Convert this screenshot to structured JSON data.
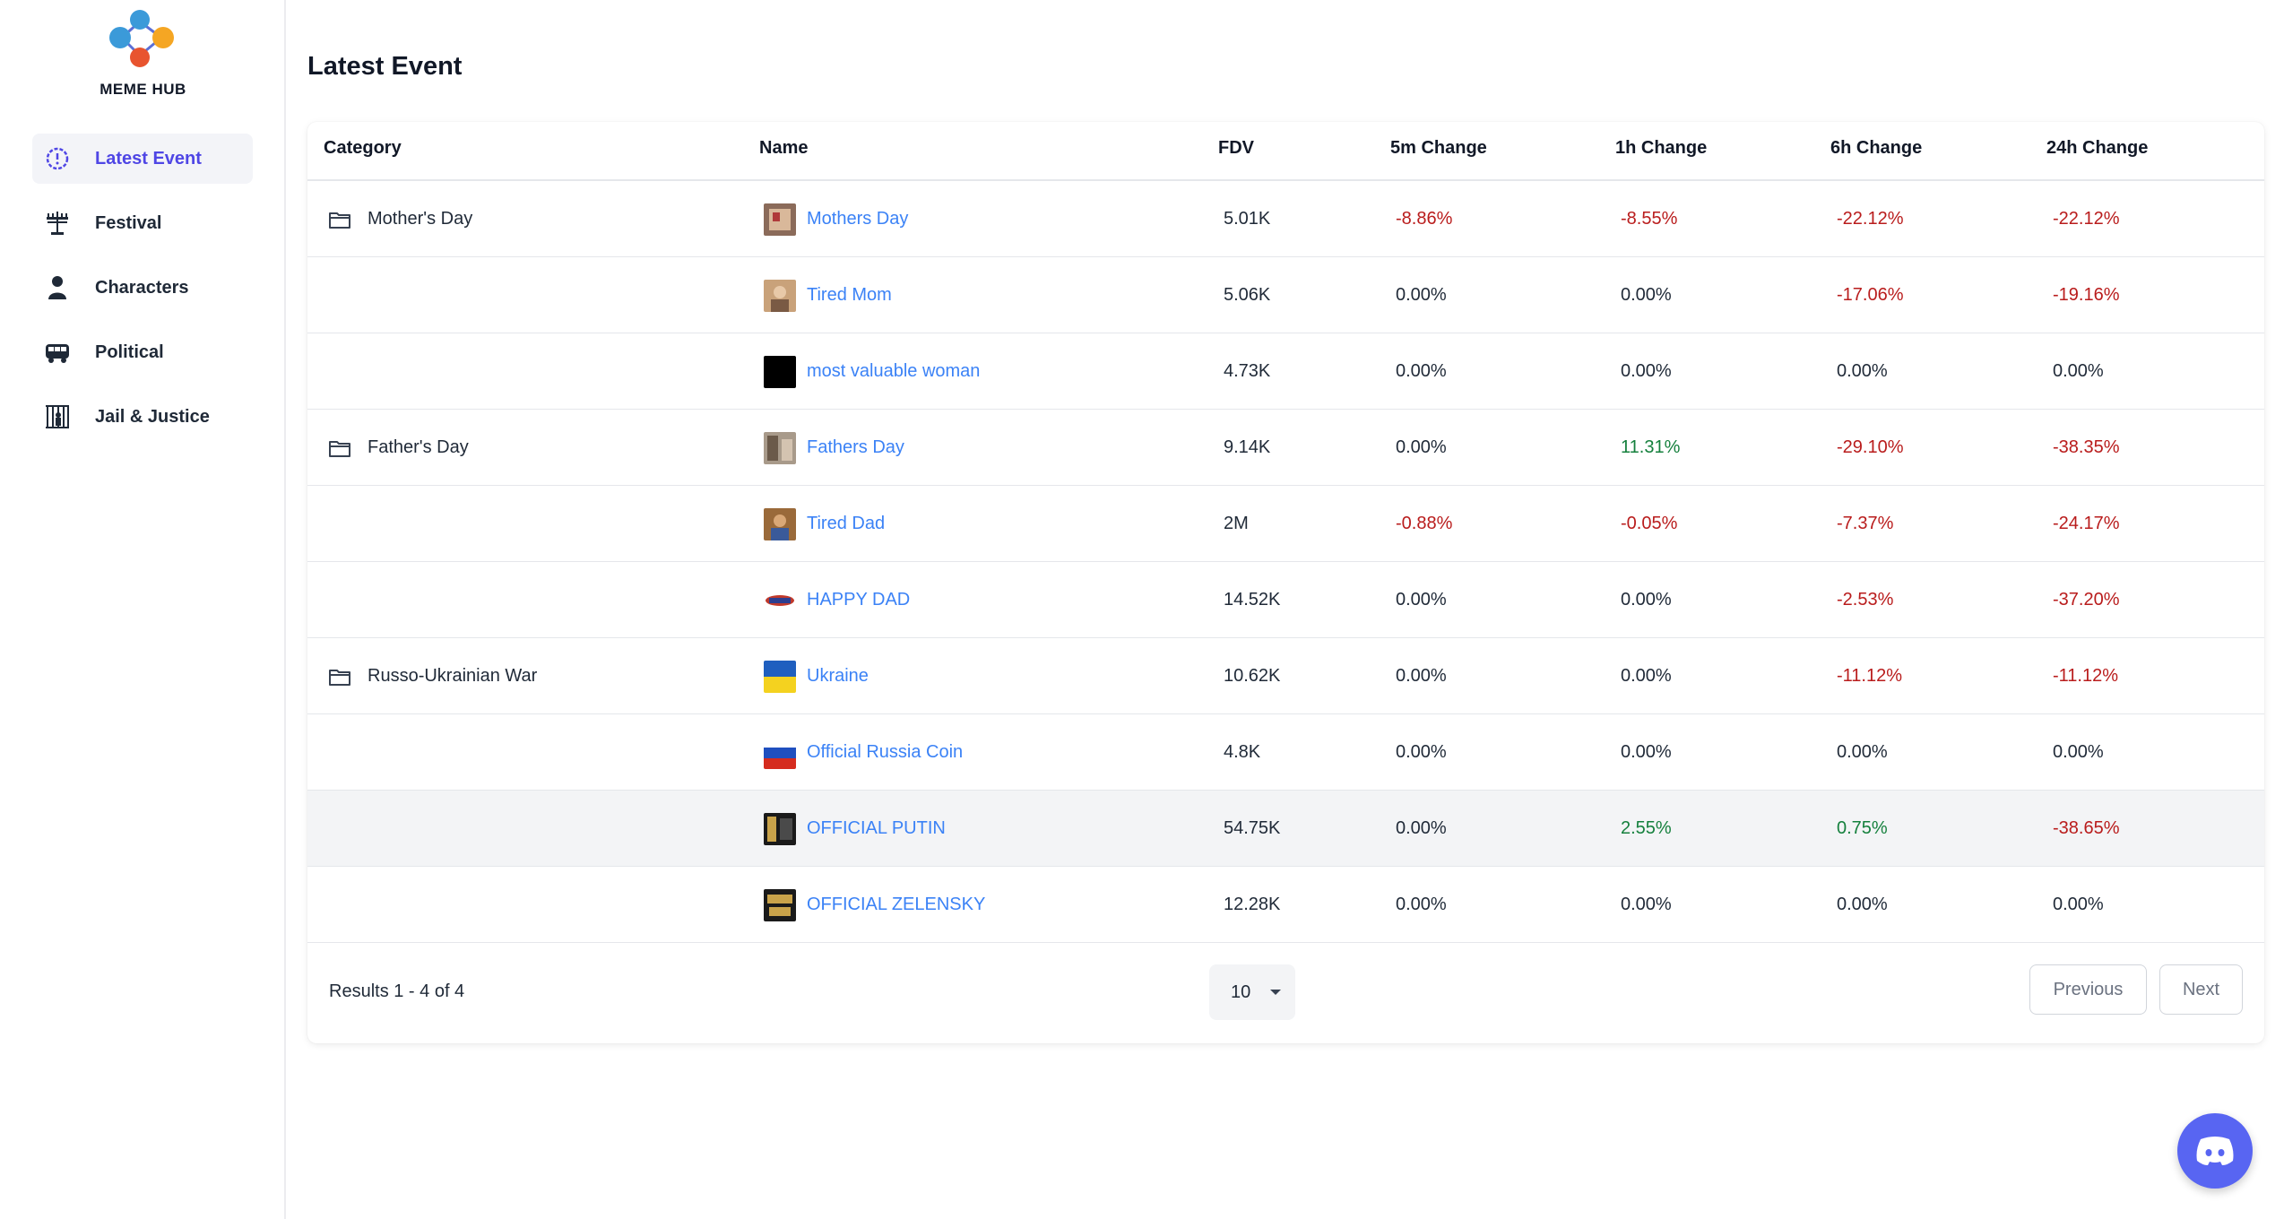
{
  "brand": {
    "name": "MEME HUB"
  },
  "sidebar": {
    "items": [
      {
        "label": "Latest Event",
        "icon": "event-clock-icon",
        "active": true
      },
      {
        "label": "Festival",
        "icon": "menorah-icon",
        "active": false
      },
      {
        "label": "Characters",
        "icon": "person-icon",
        "active": false
      },
      {
        "label": "Political",
        "icon": "bus-icon",
        "active": false
      },
      {
        "label": "Jail & Justice",
        "icon": "jail-bars-icon",
        "active": false
      }
    ]
  },
  "page": {
    "title": "Latest Event"
  },
  "table": {
    "headers": {
      "category": "Category",
      "name": "Name",
      "fdv": "FDV",
      "change5m": "5m Change",
      "change1h": "1h Change",
      "change6h": "6h Change",
      "change24h": "24h Change"
    },
    "rows": [
      {
        "category": "Mother's Day",
        "name": "Mothers Day",
        "fdv": "5.01K",
        "c5m": "-8.86%",
        "c1h": "-8.55%",
        "c6h": "-22.12%",
        "c24h": "-22.12%"
      },
      {
        "category": "",
        "name": "Tired Mom",
        "fdv": "5.06K",
        "c5m": "0.00%",
        "c1h": "0.00%",
        "c6h": "-17.06%",
        "c24h": "-19.16%"
      },
      {
        "category": "",
        "name": "most valuable woman",
        "fdv": "4.73K",
        "c5m": "0.00%",
        "c1h": "0.00%",
        "c6h": "0.00%",
        "c24h": "0.00%"
      },
      {
        "category": "Father's Day",
        "name": "Fathers Day",
        "fdv": "9.14K",
        "c5m": "0.00%",
        "c1h": "11.31%",
        "c6h": "-29.10%",
        "c24h": "-38.35%"
      },
      {
        "category": "",
        "name": "Tired Dad",
        "fdv": "2M",
        "c5m": "-0.88%",
        "c1h": "-0.05%",
        "c6h": "-7.37%",
        "c24h": "-24.17%"
      },
      {
        "category": "",
        "name": "HAPPY DAD",
        "fdv": "14.52K",
        "c5m": "0.00%",
        "c1h": "0.00%",
        "c6h": "-2.53%",
        "c24h": "-37.20%"
      },
      {
        "category": "Russo-Ukrainian War",
        "name": "Ukraine",
        "fdv": "10.62K",
        "c5m": "0.00%",
        "c1h": "0.00%",
        "c6h": "-11.12%",
        "c24h": "-11.12%"
      },
      {
        "category": "",
        "name": "Official Russia Coin",
        "fdv": "4.8K",
        "c5m": "0.00%",
        "c1h": "0.00%",
        "c6h": "0.00%",
        "c24h": "0.00%"
      },
      {
        "category": "",
        "name": "OFFICIAL PUTIN",
        "fdv": "54.75K",
        "c5m": "0.00%",
        "c1h": "2.55%",
        "c6h": "0.75%",
        "c24h": "-38.65%"
      },
      {
        "category": "",
        "name": "OFFICIAL ZELENSKY",
        "fdv": "12.28K",
        "c5m": "0.00%",
        "c1h": "0.00%",
        "c6h": "0.00%",
        "c24h": "0.00%"
      }
    ]
  },
  "footer": {
    "results": "Results 1 - 4 of 4",
    "per_page": "10",
    "prev_label": "Previous",
    "next_label": "Next"
  },
  "colors": {
    "accent": "#4f46e5",
    "link": "#3b82f6",
    "negative": "#b91c1c",
    "positive": "#15803d",
    "chat": "#5865f2"
  }
}
